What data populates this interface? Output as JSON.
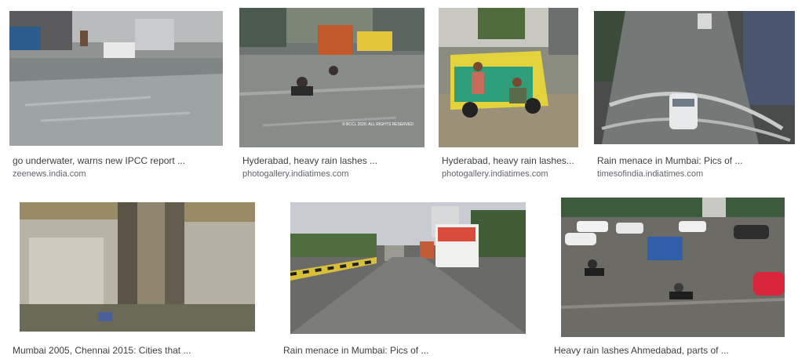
{
  "results": [
    {
      "caption": "go underwater, warns new IPCC report ...",
      "source": "zeenews.india.com"
    },
    {
      "caption": "Hyderabad, heavy rain lashes ...",
      "source": "photogallery.indiatimes.com",
      "watermark": "© BCCL 2020. ALL RIGHTS RESERVED"
    },
    {
      "caption": "Hyderabad, heavy rain lashes...",
      "source": "photogallery.indiatimes.com"
    },
    {
      "caption": "Rain menace in Mumbai: Pics of ...",
      "source": "timesofindia.indiatimes.com"
    },
    {
      "caption": "Mumbai 2005, Chennai 2015: Cities that ...",
      "source": ""
    },
    {
      "caption": "Rain menace in Mumbai: Pics of ...",
      "source": ""
    },
    {
      "caption": "Heavy rain lashes Ahmedabad, parts of ...",
      "source": ""
    }
  ]
}
